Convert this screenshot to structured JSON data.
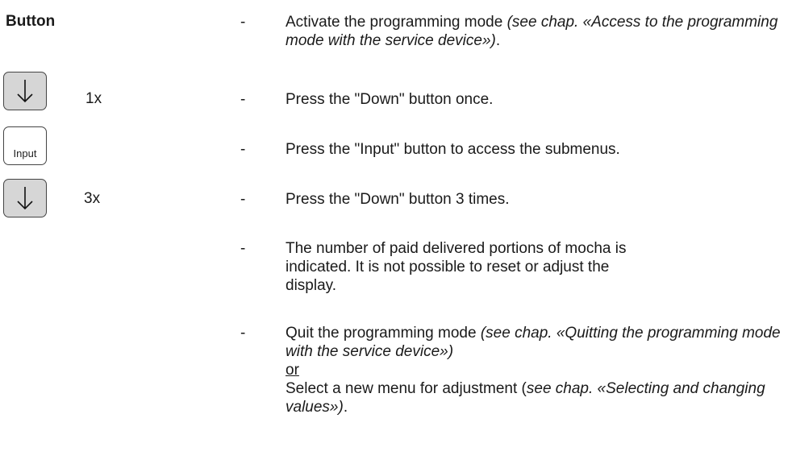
{
  "heading": "Button",
  "keys": [
    {
      "icon": "down-arrow-icon",
      "count": "1x"
    },
    {
      "label": "Input"
    },
    {
      "icon": "down-arrow-icon",
      "count": "3x"
    }
  ],
  "steps": {
    "bullet": "-",
    "s1": {
      "text": "Activate the programming mode ",
      "em": "(see chap. «Access to the programming mode with the service device»)",
      "end": "."
    },
    "s2": {
      "text": "Press the \"Down\" button once."
    },
    "s3": {
      "text": "Press the \"Input\" button to access the submenus."
    },
    "s4": {
      "text": "Press the \"Down\" button 3 times."
    },
    "s5": {
      "text": "The number of paid delivered portions of mocha is indicated. It is not possible to reset or adjust the display."
    },
    "s6": {
      "text": "Quit the programming mode ",
      "em": "(see chap. «Quitting the programming mode with the service device»)",
      "or": "or",
      "text2": "Select a new menu for adjustment (",
      "em2": "see chap. «Selecting and changing values»)",
      "end": "."
    }
  }
}
